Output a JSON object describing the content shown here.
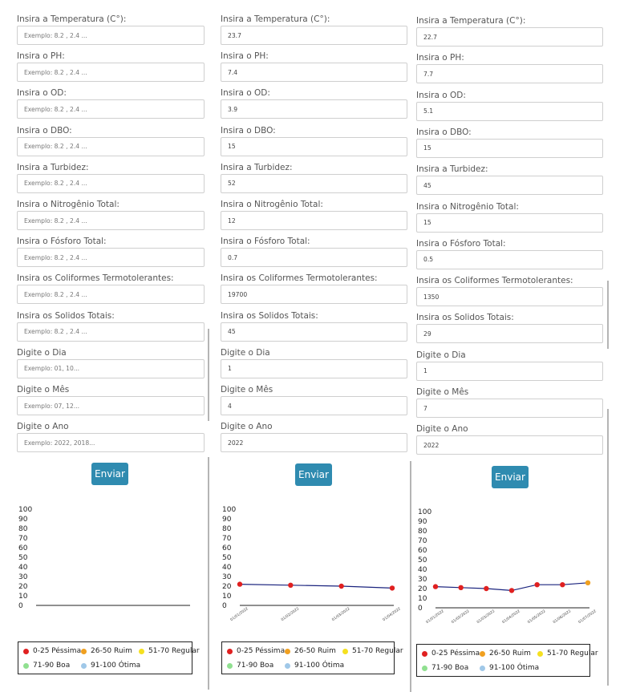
{
  "fields": [
    {
      "key": "temperatura",
      "label": "Insira a Temperatura (C°):",
      "placeholder": "Exemplo: 8.2 , 2.4 ..."
    },
    {
      "key": "ph",
      "label": "Insira o PH:",
      "placeholder": "Exemplo: 8.2 , 2.4 ..."
    },
    {
      "key": "od",
      "label": "Insira o OD:",
      "placeholder": "Exemplo: 8.2 , 2.4 ..."
    },
    {
      "key": "dbo",
      "label": "Insira o DBO:",
      "placeholder": "Exemplo: 8.2 , 2.4 ..."
    },
    {
      "key": "turbidez",
      "label": "Insira a Turbidez:",
      "placeholder": "Exemplo: 8.2 , 2.4 ..."
    },
    {
      "key": "nitrogenio",
      "label": "Insira o Nitrogênio Total:",
      "placeholder": "Exemplo: 8.2 , 2.4 ..."
    },
    {
      "key": "fosforo",
      "label": "Insira o Fósforo Total:",
      "placeholder": "Exemplo: 8.2 , 2.4 ..."
    },
    {
      "key": "coliformes",
      "label": "Insira os Coliformes Termotolerantes:",
      "placeholder": "Exemplo: 8.2 , 2.4 ..."
    },
    {
      "key": "solidos",
      "label": "Insira os Solidos Totais:",
      "placeholder": "Exemplo: 8.2 , 2.4 ..."
    },
    {
      "key": "dia",
      "label": "Digite o Dia",
      "placeholder": "Exemplo: 01, 10..."
    },
    {
      "key": "mes",
      "label": "Digite o Mês",
      "placeholder": "Exemplo: 07, 12..."
    },
    {
      "key": "ano",
      "label": "Digite o Ano",
      "placeholder": "Exemplo: 2022, 2018..."
    }
  ],
  "panels": [
    {
      "values": [
        "",
        "",
        "",
        "",
        "",
        "",
        "",
        "",
        "",
        "",
        "",
        ""
      ]
    },
    {
      "values": [
        "23.7",
        "7.4",
        "3.9",
        "15",
        "52",
        "12",
        "0.7",
        "19700",
        "45",
        "1",
        "4",
        "2022"
      ]
    },
    {
      "values": [
        "22.7",
        "7.7",
        "5.1",
        "15",
        "45",
        "15",
        "0.5",
        "1350",
        "29",
        "1",
        "7",
        "2022"
      ]
    }
  ],
  "submit_label": "Enviar",
  "legend": [
    {
      "label": "0-25 Péssima",
      "color": "#e02020"
    },
    {
      "label": "26-50 Ruim",
      "color": "#f0a020"
    },
    {
      "label": "51-70 Regular",
      "color": "#f5e020"
    },
    {
      "label": "71-90 Boa",
      "color": "#90e090"
    },
    {
      "label": "91-100 Ótima",
      "color": "#a0c8e8"
    }
  ],
  "chart_data": [
    {
      "type": "line",
      "x": [],
      "values": [],
      "ylim": [
        0,
        100
      ],
      "yticks": [
        0,
        10,
        20,
        30,
        40,
        50,
        60,
        70,
        80,
        90,
        100
      ],
      "point_colors": []
    },
    {
      "type": "line",
      "x": [
        "01/01/2022",
        "01/02/2022",
        "01/03/2022",
        "01/04/2022"
      ],
      "values": [
        22,
        21,
        20,
        18
      ],
      "ylim": [
        0,
        100
      ],
      "yticks": [
        0,
        10,
        20,
        30,
        40,
        50,
        60,
        70,
        80,
        90,
        100
      ],
      "point_colors": [
        "#e02020",
        "#e02020",
        "#e02020",
        "#e02020"
      ]
    },
    {
      "type": "line",
      "x": [
        "01/01/2022",
        "01/02/2022",
        "01/03/2022",
        "01/04/2022",
        "01/05/2022",
        "01/06/2022",
        "01/07/2022"
      ],
      "values": [
        22,
        21,
        20,
        18,
        24,
        24,
        26
      ],
      "ylim": [
        0,
        100
      ],
      "yticks": [
        0,
        10,
        20,
        30,
        40,
        50,
        60,
        70,
        80,
        90,
        100
      ],
      "point_colors": [
        "#e02020",
        "#e02020",
        "#e02020",
        "#e02020",
        "#e02020",
        "#e02020",
        "#f0a020"
      ]
    }
  ],
  "colors": {
    "button": "#2f8bb0",
    "line": "#1a237e",
    "axis": "#222222"
  }
}
